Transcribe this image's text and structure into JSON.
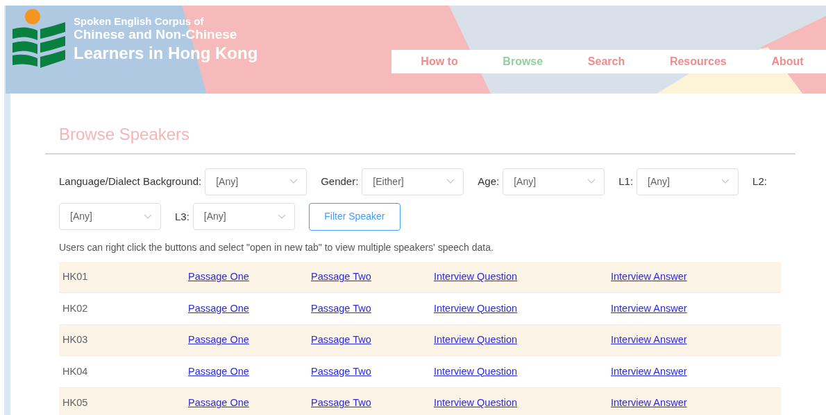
{
  "site_title": {
    "line_1": "Spoken English Corpus of",
    "line_2": "Chinese and Non-Chinese",
    "line_3": "Learners in Hong Kong"
  },
  "nav": [
    {
      "label": "How to",
      "selected": false
    },
    {
      "label": "Browse",
      "selected": true
    },
    {
      "label": "Search",
      "selected": false
    },
    {
      "label": "Resources",
      "selected": false
    },
    {
      "label": "About",
      "selected": false
    }
  ],
  "heading": "Browse Speakers",
  "filters": [
    {
      "kind": "label",
      "text": "Language/Dialect Background:"
    },
    {
      "kind": "dropdown",
      "value": "[Any]"
    },
    {
      "kind": "label",
      "text": "Gender:"
    },
    {
      "kind": "dropdown",
      "value": "[Either]"
    },
    {
      "kind": "label",
      "text": "Age:"
    },
    {
      "kind": "dropdown",
      "value": "[Any]"
    },
    {
      "kind": "label",
      "text": "L1:"
    },
    {
      "kind": "dropdown",
      "value": "[Any]"
    },
    {
      "kind": "label",
      "text": "L2:"
    },
    {
      "kind": "dropdown",
      "value": "[Any]"
    },
    {
      "kind": "label",
      "text": "L3:"
    },
    {
      "kind": "dropdown",
      "value": "[Any]"
    }
  ],
  "filter_button": "Filter Speaker",
  "hint": "Users can right click the buttons and select \"open in new tab\" to view multiple speakers' speech data.",
  "rows": [
    {
      "speaker": "HK01",
      "links": [
        "Passage One",
        "Passage Two",
        "Interview Question",
        "Interview Answer"
      ]
    },
    {
      "speaker": "HK02",
      "links": [
        "Passage One",
        "Passage Two",
        "Interview Question",
        "Interview Answer"
      ]
    },
    {
      "speaker": "HK03",
      "links": [
        "Passage One",
        "Passage Two",
        "Interview Question",
        "Interview Answer"
      ]
    },
    {
      "speaker": "HK04",
      "links": [
        "Passage One",
        "Passage Two",
        "Interview Question",
        "Interview Answer"
      ]
    },
    {
      "speaker": "HK05",
      "links": [
        "Passage One",
        "Passage Two",
        "Interview Question",
        "Interview Answer"
      ]
    }
  ]
}
